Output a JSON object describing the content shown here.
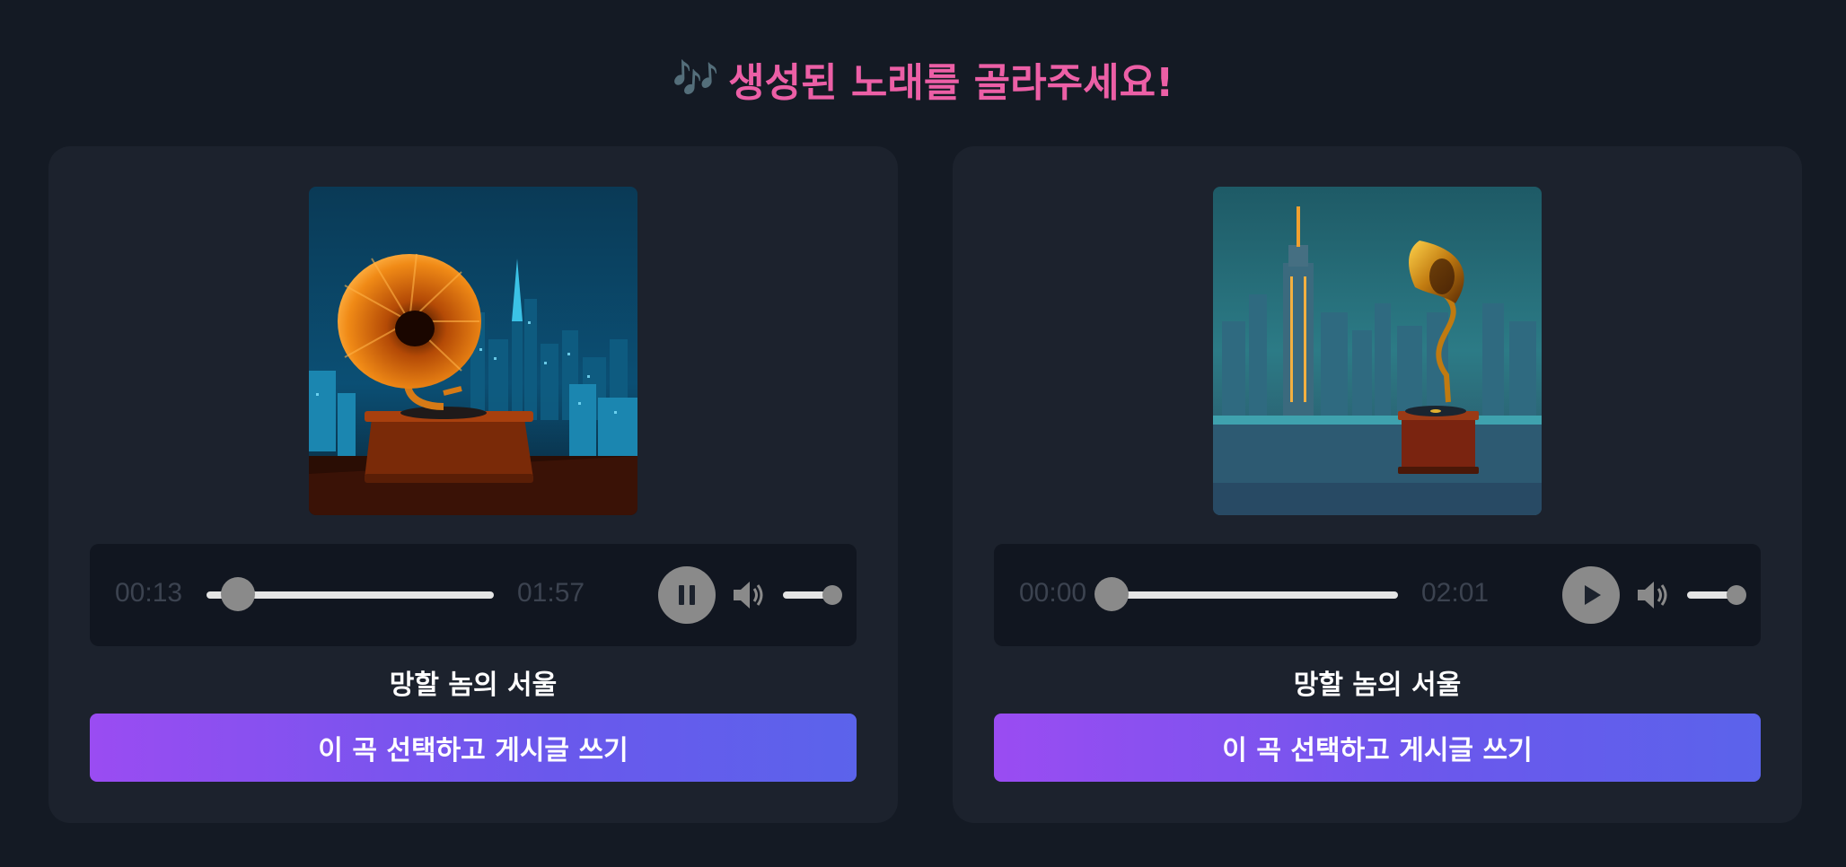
{
  "header": {
    "notes_glyph": "🎶",
    "title": "생성된 노래를 골라주세요!"
  },
  "songs": [
    {
      "cover_icon": "gramophone-night-city-image",
      "current_time": "00:13",
      "duration": "01:57",
      "progress": 0.11,
      "state": "playing",
      "control_icon": "pause-icon",
      "volume": 1.0,
      "title": "망할 놈의 서울",
      "button_label": "이 곡 선택하고 게시글 쓰기"
    },
    {
      "cover_icon": "gramophone-skyline-image",
      "current_time": "00:00",
      "duration": "02:01",
      "progress": 0.0,
      "state": "paused",
      "control_icon": "play-icon",
      "volume": 1.0,
      "title": "망할 놈의 서울",
      "button_label": "이 곡 선택하고 게시글 쓰기"
    }
  ],
  "colors": {
    "background": "#141a24",
    "card": "#1c222d",
    "title": "#ec5fa6",
    "button_gradient_start": "#9a4cf2",
    "button_gradient_end": "#5b63eb"
  }
}
